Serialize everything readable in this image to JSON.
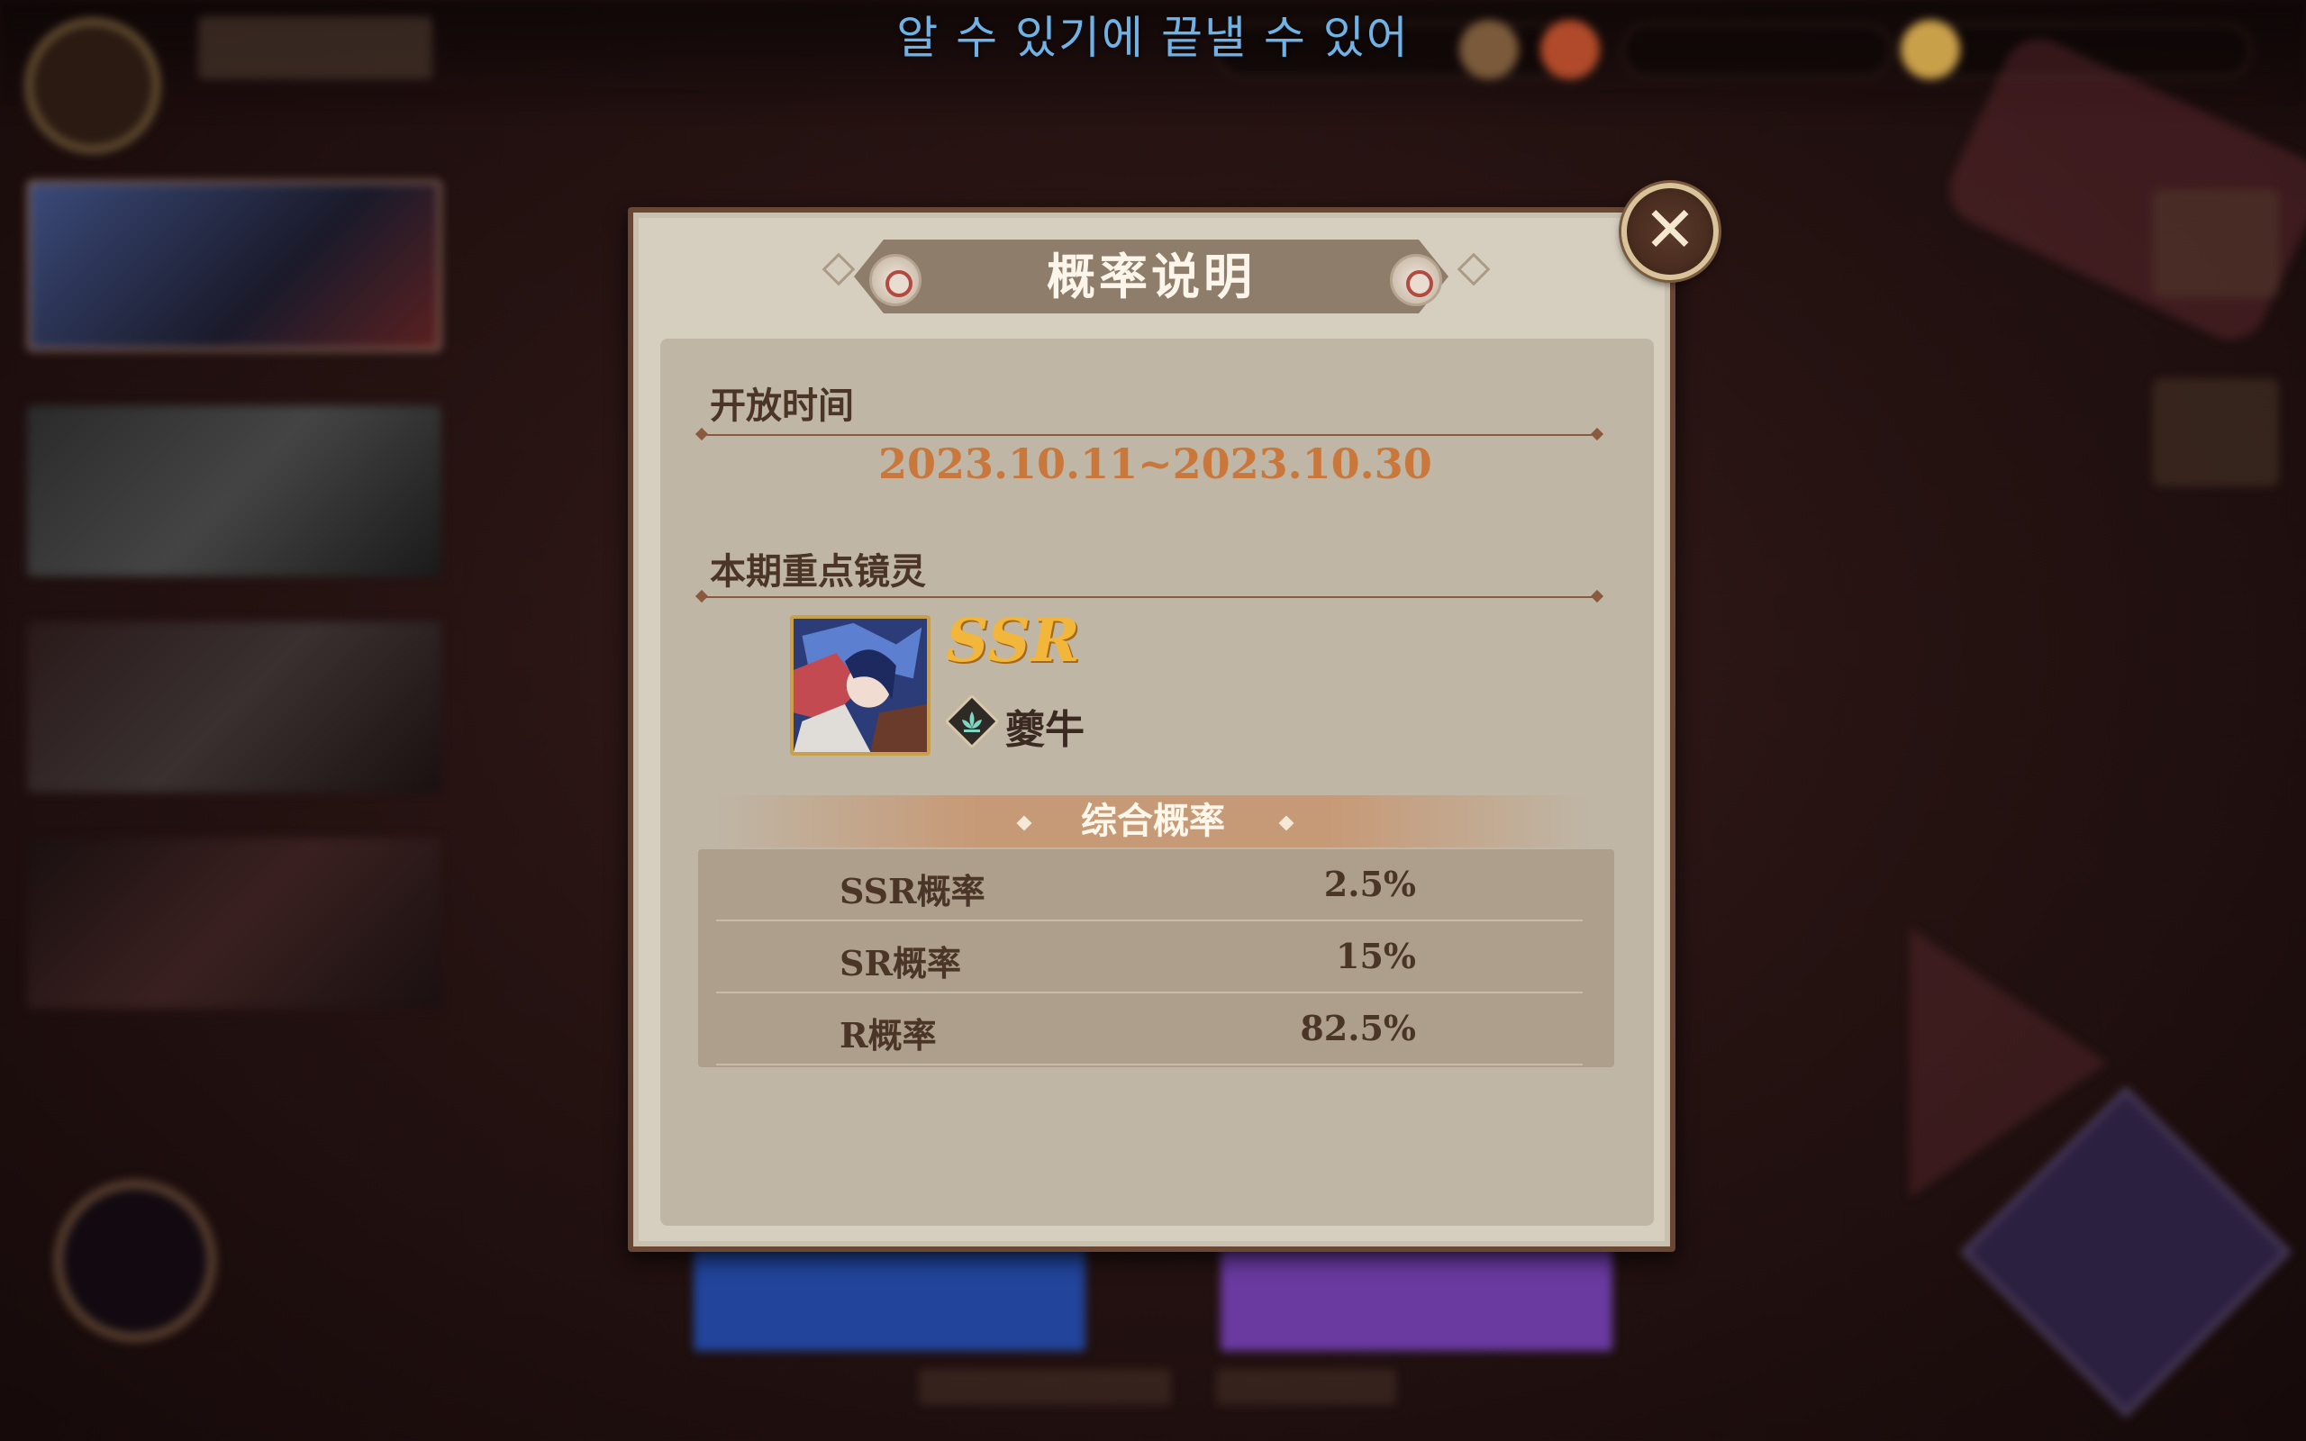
{
  "subtitle": "알 수 있기에 끝낼 수 있어",
  "dialog": {
    "title": "概率说明",
    "open_time_heading": "开放时间",
    "date_range": "2023.10.11~2023.10.30",
    "featured_heading": "本期重点镜灵",
    "featured": {
      "rarity": "SSR",
      "element_icon": "lotus-element-icon",
      "name": "夔牛"
    },
    "probability_heading": "综合概率",
    "probabilities": [
      {
        "label": "SSR概率",
        "value": "2.5%"
      },
      {
        "label": "SR概率",
        "value": "15%"
      },
      {
        "label": "R概率",
        "value": "82.5%"
      }
    ],
    "close_icon": "close-icon"
  },
  "colors": {
    "accent_orange": "#c9773a",
    "rarity_gold": "#f2b63a",
    "subtitle_blue": "#6fb3e6",
    "panel": "#d6cfbf",
    "frame": "#6a4634"
  }
}
